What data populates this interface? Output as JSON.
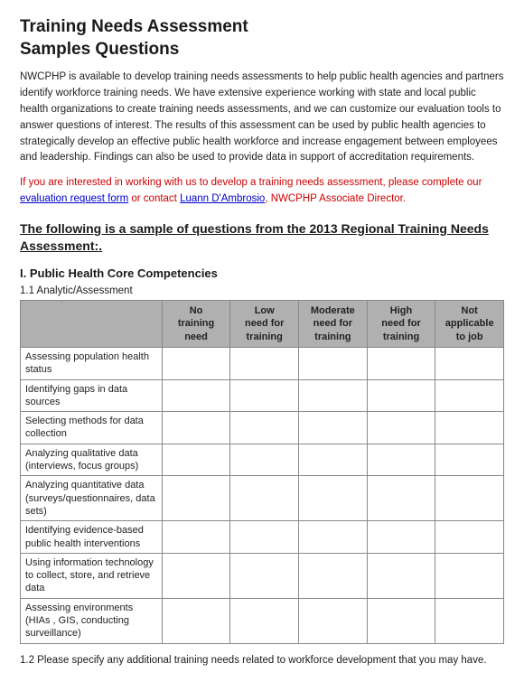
{
  "page": {
    "title_line1": "Training Needs Assessment",
    "title_line2": "Samples Questions",
    "intro": "NWCPHP is available to develop training needs assessments to help public health agencies and partners identify workforce training needs. We have extensive experience working with state and local public health organizations to create training needs assessments, and we can customize our evaluation tools to answer questions of interest. The results of this assessment can be used by public health agencies to strategically develop an effective public health workforce and increase engagement between employees and leadership. Findings can also be used to provide data in support of accreditation requirements.",
    "contact_prefix": "If you are interested in working with us to develop a training needs assessment, please complete our ",
    "contact_link_text": "evaluation request form",
    "contact_middle": " or contact ",
    "contact_name": "Luann D'Ambrosio",
    "contact_suffix": ", NWCPHP Associate Director.",
    "sample_heading": "The following is a sample of questions from the 2013 Regional Training Needs Assessment:.",
    "section": {
      "title": "I. Public Health Core Competencies",
      "subsection_label": "1.1  Analytic/Assessment",
      "table": {
        "columns": [
          "No training need",
          "Low need for training",
          "Moderate need for training",
          "High need for training",
          "Not applicable to job"
        ],
        "rows": [
          "Assessing population health status",
          "Identifying gaps in data sources",
          "Selecting methods for data collection",
          "Analyzing qualitative data (interviews, focus groups)",
          "Analyzing quantitative data (surveys/questionnaires, data sets)",
          "Identifying evidence-based public health interventions",
          "Using information technology to collect, store, and retrieve data",
          "Assessing environments (HIAs , GIS,  conducting surveillance)"
        ]
      },
      "footnote": "1.2  Please specify any additional training needs related to workforce development that you may have."
    }
  }
}
